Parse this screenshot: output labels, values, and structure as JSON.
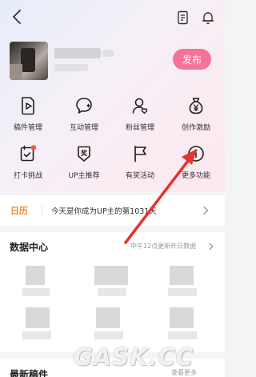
{
  "header": {
    "back_icon": "chevron-left-icon",
    "notes_icon": "document-icon",
    "bell_icon": "bell-icon"
  },
  "profile": {
    "publish_label": "发布"
  },
  "tools": [
    {
      "label": "稿件管理",
      "icon": "manuscript-icon"
    },
    {
      "label": "互动管理",
      "icon": "chat-bubble-icon"
    },
    {
      "label": "粉丝管理",
      "icon": "fans-icon"
    },
    {
      "label": "创作激励",
      "icon": "money-bag-icon"
    },
    {
      "label": "打卡挑战",
      "icon": "checkin-calendar-icon"
    },
    {
      "label": "UP主推荐",
      "icon": "badge-icon"
    },
    {
      "label": "有奖活动",
      "icon": "flag-icon"
    },
    {
      "label": "更多功能",
      "icon": "more-icon"
    }
  ],
  "calendar": {
    "tag": "日历",
    "text": "今天是你成为UP主的第1031天"
  },
  "data_center": {
    "title": "数据中心",
    "note": "中午12点更新昨日数据"
  },
  "recent": {
    "title": "最新稿件",
    "more": "查看更多"
  },
  "colors": {
    "accent_pink": "#f6729b",
    "calendar_orange": "#f28a2c",
    "arrow_red": "#e8322d"
  },
  "watermark": "GASK.CC"
}
